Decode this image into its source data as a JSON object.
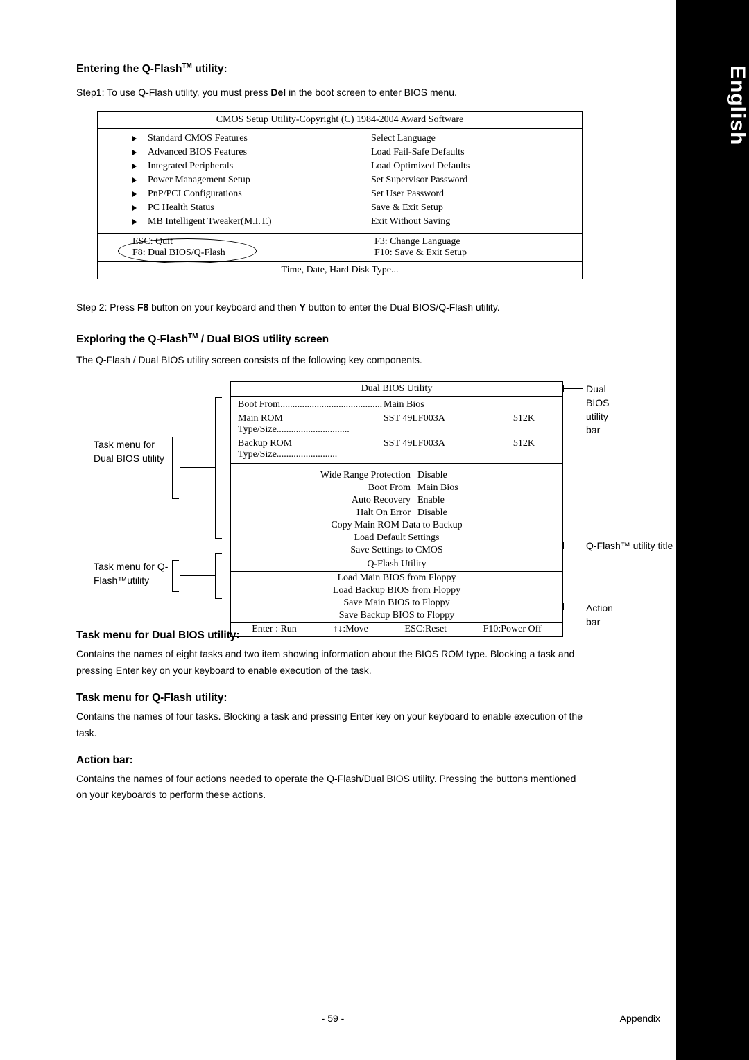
{
  "lang_tab": "English",
  "h_entering": "Entering the Q-Flash",
  "h_entering_tm": "TM",
  "h_entering_suffix": " utility:",
  "step1_prefix": "Step1: To use Q-Flash utility, you must press ",
  "step1_key": "Del",
  "step1_suffix": " in the boot screen to enter BIOS menu.",
  "bios": {
    "title": "CMOS Setup Utility-Copyright (C) 1984-2004 Award Software",
    "left": [
      "Standard CMOS Features",
      "Advanced BIOS Features",
      "Integrated Peripherals",
      "Power Management Setup",
      "PnP/PCI Configurations",
      "PC Health Status",
      "MB Intelligent Tweaker(M.I.T.)"
    ],
    "right": [
      "Select Language",
      "Load Fail-Safe Defaults",
      "Load Optimized Defaults",
      "Set Supervisor Password",
      "Set User Password",
      "Save & Exit Setup",
      "Exit Without Saving"
    ],
    "hint_left1": "ESC: Quit",
    "hint_left2": "F8: Dual BIOS/Q-Flash",
    "hint_right1": "F3: Change Language",
    "hint_right2": "F10: Save & Exit Setup",
    "footer": "Time, Date, Hard Disk Type..."
  },
  "step2_prefix": "Step 2: Press ",
  "step2_key1": "F8",
  "step2_mid": " button on your keyboard and then ",
  "step2_key2": "Y",
  "step2_suffix": " button to enter the Dual BIOS/Q-Flash utility.",
  "h_exploring": "Exploring the Q-Flash",
  "h_exploring_suffix": " / Dual BIOS utility screen",
  "explore_desc": "The Q-Flash / Dual BIOS utility screen consists of the following key components.",
  "util": {
    "title": "Dual BIOS Utility",
    "bootfrom_lab": "Boot From",
    "bootfrom_val": "Main Bios",
    "main_lab": "Main ROM Type/Size",
    "main_val": "SST 49LF003A",
    "main_size": "512K",
    "backup_lab": "Backup ROM Type/Size",
    "backup_val": "SST 49LF003A",
    "backup_size": "512K",
    "opts": [
      {
        "k": "Wide Range Protection",
        "v": "Disable"
      },
      {
        "k": "Boot From",
        "v": "Main Bios"
      },
      {
        "k": "Auto Recovery",
        "v": "Enable"
      },
      {
        "k": "Halt On Error",
        "v": "Disable"
      }
    ],
    "cmds": [
      "Copy Main ROM Data to Backup",
      "Load Default Settings",
      "Save Settings to CMOS"
    ],
    "qtitle": "Q-Flash Utility",
    "qitems": [
      "Load Main BIOS from Floppy",
      "Load Backup BIOS from Floppy",
      "Save Main BIOS to Floppy",
      "Save Backup BIOS to Floppy"
    ],
    "actions": [
      "Enter : Run",
      "↑↓:Move",
      "ESC:Reset",
      "F10:Power Off"
    ]
  },
  "callouts": {
    "dual_bar": "Dual BIOS utility bar",
    "dual_menu": "Task menu for Dual BIOS utility",
    "q_title_bar": "Q-Flash™ utility title bar",
    "q_menu": "Task menu for Q-Flash™utility",
    "action_bar": "Action bar"
  },
  "sec1_head": "Task menu for Dual BIOS utility:",
  "sec1_body": "Contains the names of eight tasks and two item showing information about the BIOS ROM type. Blocking a task and pressing Enter key on your keyboard to enable execution of the task.",
  "sec2_head": "Task menu for Q-Flash utility:",
  "sec2_body": "Contains the names of four tasks. Blocking a task and pressing Enter key on your keyboard to enable execution of the task.",
  "sec3_head": "Action bar:",
  "sec3_body": "Contains the names of four actions needed to operate the Q-Flash/Dual BIOS utility. Pressing the buttons mentioned on your keyboards to perform these actions.",
  "page_num": "- 59 -",
  "appendix": "Appendix"
}
